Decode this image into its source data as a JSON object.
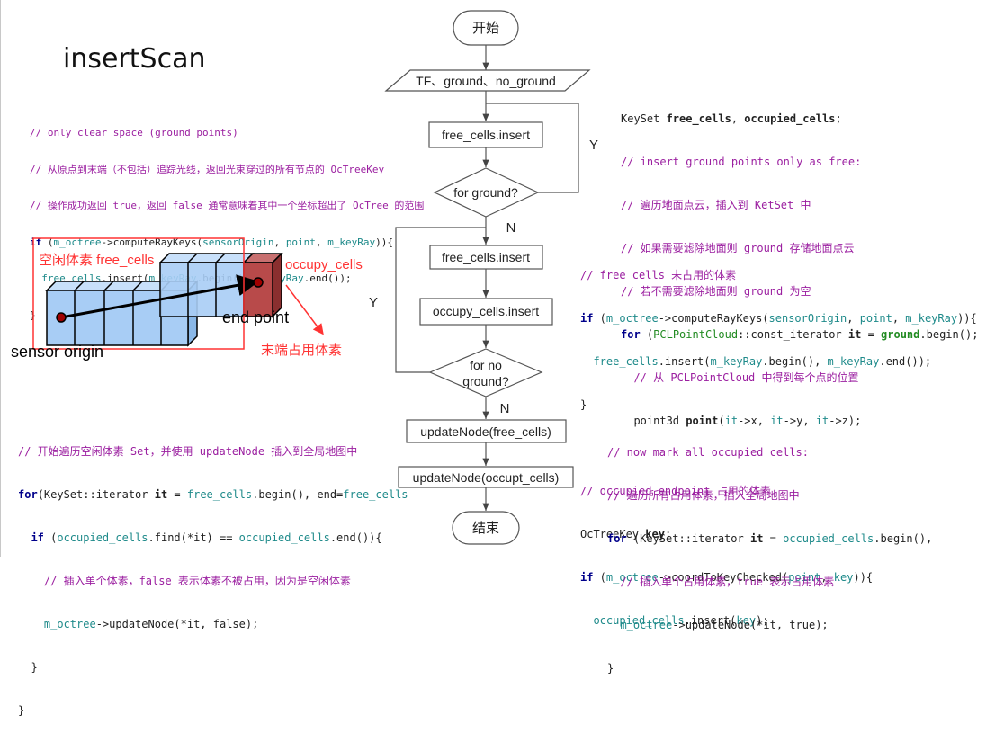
{
  "title": "insertScan",
  "code_top_left": {
    "lines": [
      "// only clear space (ground points)",
      "// 从原点到末端（不包括）追踪光线，返回光束穿过的所有节点的 OcTreeKey",
      "// 操作成功返回 true，返回 false 通常意味着其中一个坐标超出了 OcTree 的范围",
      "if (m_octree->computeRayKeys(sensorOrigin, point, m_keyRay)){",
      "  free_cells.insert(m_keyRay.begin(), m_keyRay.end());",
      "}"
    ]
  },
  "code_top_right": {
    "lines": [
      "KeySet free_cells, occupied_cells;",
      "// insert ground points only as free:",
      "// 遍历地面点云，插入到 KetSet 中",
      "// 如果需要滤除地面则 ground 存储地面点云",
      "// 若不需要滤除地面则 ground 为空",
      "for (PCLPointCloud::const_iterator it = ground.begin();",
      "  // 从 PCLPointCloud 中得到每个点的位置",
      "  point3d point(it->x, it->y, it->z);"
    ]
  },
  "code_mid_right": {
    "lines": [
      "// free cells 未占用的体素",
      "if (m_octree->computeRayKeys(sensorOrigin, point, m_keyRay)){",
      "  free_cells.insert(m_keyRay.begin(), m_keyRay.end());",
      "}",
      "",
      "// occupied endpoint 占用的体素",
      "OcTreeKey key;",
      "if (m_octree->coordToKeyChecked(point, key)){",
      "  occupied_cells.insert(key);"
    ]
  },
  "code_bottom_left": {
    "lines": [
      "// 开始遍历空闲体素 Set，并使用 updateNode 插入到全局地图中",
      "for(KeySet::iterator it = free_cells.begin(), end=free_cells",
      "  if (occupied_cells.find(*it) == occupied_cells.end()){",
      "    // 插入单个体素，false 表示体素不被占用，因为是空闲体素",
      "    m_octree->updateNode(*it, false);",
      "  }",
      "}"
    ]
  },
  "code_bottom_right": {
    "lines": [
      "// now mark all occupied cells:",
      "// 遍历所有占用体素，插入全局地图中",
      "for (KeySet::iterator it = occupied_cells.begin(),",
      "  // 插入单个占用体素，true 表示占用体素",
      "  m_octree->updateNode(*it, true);",
      "}"
    ]
  },
  "voxel_diagram": {
    "free_label": "空闲体素  free_cells",
    "occupy_label": "occupy_cells",
    "end_point_label": "end point",
    "sensor_origin_label": "sensor origin",
    "end_occupied_label": "末端占用体素",
    "colors": {
      "annotation": "#ff3333",
      "free_voxel": "#a8cdf5",
      "occupied_voxel": "#b84a4a",
      "point": "#a00000"
    }
  },
  "flowchart": {
    "start": "开始",
    "input": "TF、ground、no_ground",
    "step1": "free_cells.insert",
    "decision1": "for ground?",
    "yes1": "Y",
    "no1": "N",
    "step2": "free_cells.insert",
    "step3": "occupy_cells.insert",
    "decision2_line1": "for no",
    "decision2_line2": "ground?",
    "yes2": "Y",
    "no2": "N",
    "step4": "updateNode(free_cells)",
    "step5": "updateNode(occupt_cells)",
    "end": "结束"
  }
}
